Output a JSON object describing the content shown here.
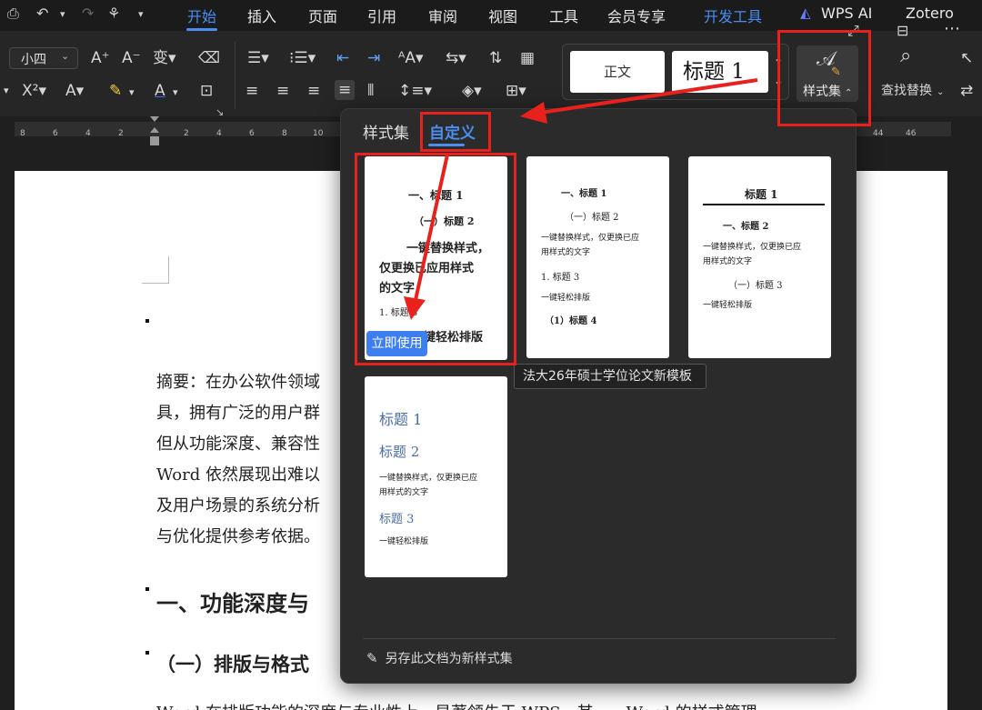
{
  "menu": {
    "tabs": [
      {
        "label": "开始",
        "active": true
      },
      {
        "label": "插入"
      },
      {
        "label": "页面"
      },
      {
        "label": "引用"
      },
      {
        "label": "审阅"
      },
      {
        "label": "视图"
      },
      {
        "label": "工具"
      },
      {
        "label": "会员专享"
      },
      {
        "label": "开发工具"
      },
      {
        "label": "WPS AI"
      },
      {
        "label": "Zotero"
      }
    ]
  },
  "ribbon": {
    "font_size": "小四",
    "style_normal": "正文",
    "style_heading1": "标题  1",
    "style_set_label": "样式集",
    "find_replace_label": "查找替换"
  },
  "ruler": {
    "ticks": [
      "8",
      "6",
      "4",
      "2",
      "2",
      "4",
      "6",
      "8",
      "10",
      "44",
      "46"
    ]
  },
  "document": {
    "lines": [
      "摘要：在办公软件领域",
      "具，拥有广泛的用户群",
      "但从功能深度、兼容性",
      "Word 依然展现出难以",
      "及用户场景的系统分析",
      "与优化提供参考依据。"
    ],
    "heading1": "一、功能深度与",
    "heading2": "（一）排版与格式",
    "last_line": "Word 在排版功能的深度与专业性上，显著领先于 WPS。其一，Word 的样式管理"
  },
  "panel": {
    "tabs": [
      "样式集",
      "自定义"
    ],
    "active_tab": "自定义",
    "templates": [
      {
        "lines": [
          "一、标题 1",
          "（一）标题 2",
          "一键替换样式，",
          "仅更换已应用样式",
          "的文字",
          "1.  标题 3",
          "一键轻松排版"
        ],
        "button": "立即使用"
      },
      {
        "lines": [
          "一、标题 1",
          "（一）标题 2",
          "一键替换样式，仅更换已应",
          "用样式的文字",
          "1.  标题 3",
          "一键轻松排版",
          "（1）标题 4"
        ]
      },
      {
        "lines": [
          "标题 1",
          "一、标题 2",
          "一键替换样式，仅更换已应",
          "用样式的文字",
          "（一）标题 3",
          "一键轻松排版"
        ]
      },
      {
        "lines": [
          "标题 1",
          "标题 2",
          "一键替换样式，仅更换已应",
          "用样式的文字",
          "标题 3",
          "一键轻松排版"
        ]
      }
    ],
    "tooltip": "法大26年硕士学位论文新模板",
    "save_as_set": "另存此文档为新样式集"
  },
  "colors": {
    "accent": "#4a8ef2",
    "annotation_red": "#e8211c",
    "template_blue": "#4a6fa5"
  }
}
